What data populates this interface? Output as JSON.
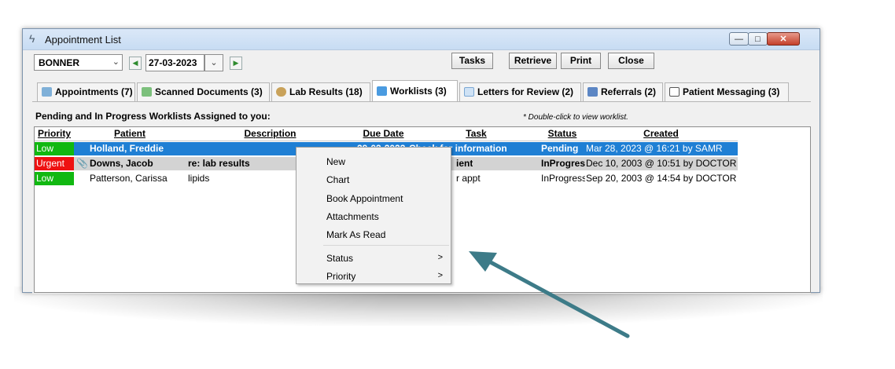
{
  "window": {
    "title": "Appointment List"
  },
  "toolbar": {
    "provider": "BONNER",
    "date": "27-03-2023",
    "buttons": [
      "Tasks",
      "Retrieve",
      "Print",
      "Close"
    ]
  },
  "tabs": [
    {
      "label": "Appointments (7)",
      "icon": "calendar-icon"
    },
    {
      "label": "Scanned Documents (3)",
      "icon": "scanner-icon"
    },
    {
      "label": "Lab Results (18)",
      "icon": "lab-flask-icon"
    },
    {
      "label": "Worklists (3)",
      "icon": "worklist-icon",
      "active": true
    },
    {
      "label": "Letters for Review (2)",
      "icon": "envelope-icon"
    },
    {
      "label": "Referrals (2)",
      "icon": "referral-icon"
    },
    {
      "label": "Patient Messaging (3)",
      "icon": "message-icon"
    }
  ],
  "worklist": {
    "heading": "Pending and In Progress Worklists Assigned to you:",
    "hint": "* Double-click to view worklist.",
    "columns": [
      "Priority",
      "Patient",
      "Description",
      "Due Date",
      "Task",
      "Status",
      "Created"
    ],
    "rows": [
      {
        "priority": "Low",
        "patient": "Holland, Freddie",
        "description": "",
        "due": "29-03-2023",
        "task": "Check for information",
        "status": "Pending",
        "created": "Mar 28, 2023 @ 16:21 by SAMR"
      },
      {
        "priority": "Urgent",
        "patient": "Downs, Jacob",
        "description": "re: lab results",
        "due": "",
        "task": "ient",
        "status": "InProgres",
        "created": "Dec 10, 2003 @ 10:51 by DOCTOR"
      },
      {
        "priority": "Low",
        "patient": "Patterson, Carissa",
        "description": "lipids",
        "due": "",
        "task": "r appt",
        "status": "InProgress",
        "created": "Sep 20, 2003 @ 14:54 by DOCTOR"
      }
    ]
  },
  "context_menu": {
    "items": [
      "New",
      "Chart",
      "Book Appointment",
      "Attachments",
      "Mark As Read"
    ],
    "submenus": [
      "Status",
      "Priority"
    ]
  },
  "colors": {
    "low": "#11b811",
    "urgent": "#ee1111",
    "selection": "#1f7fd4",
    "annotation_arrow": "#3d7b88"
  }
}
